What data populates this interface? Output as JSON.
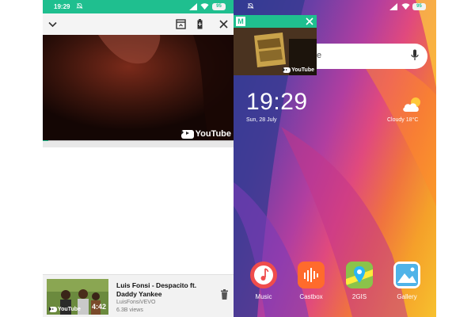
{
  "left_phone": {
    "status": {
      "time": "19:29",
      "battery": "95"
    },
    "video": {
      "logo_text": "YouTube",
      "progress": 0.03
    },
    "now_playing": {
      "title": "Luis Fonsi - Despacito ft. Daddy Yankee",
      "channel": "LuisFonsiVEVO",
      "views": "6.3B views",
      "duration": "4:42",
      "thumb_logo": "YouTube"
    }
  },
  "right_phone": {
    "status": {
      "battery": "95"
    },
    "pip": {
      "app_letter": "M",
      "logo_text": "YouTube"
    },
    "search": {
      "partial_text": "e"
    },
    "clock": {
      "time": "19:29",
      "date": "Sun, 28 July"
    },
    "weather": {
      "text": "Cloudy  18°C"
    },
    "apps": [
      {
        "label": "Music",
        "color": "#ef4c4c"
      },
      {
        "label": "Castbox",
        "color": "#ff6b2c"
      },
      {
        "label": "2GIS",
        "color": "#4caf50"
      },
      {
        "label": "Gallery",
        "color": "#4fb3e8"
      }
    ]
  },
  "colors": {
    "accent": "#1fbf8f",
    "dark": "#2a0f0a"
  },
  "icons": [
    "chevron-down-icon",
    "open-in-app-icon",
    "battery-saver-icon",
    "close-icon",
    "alarm-off-icon",
    "signal-icon",
    "wifi-icon",
    "mic-icon",
    "trash-icon",
    "cloud-sun-icon"
  ]
}
